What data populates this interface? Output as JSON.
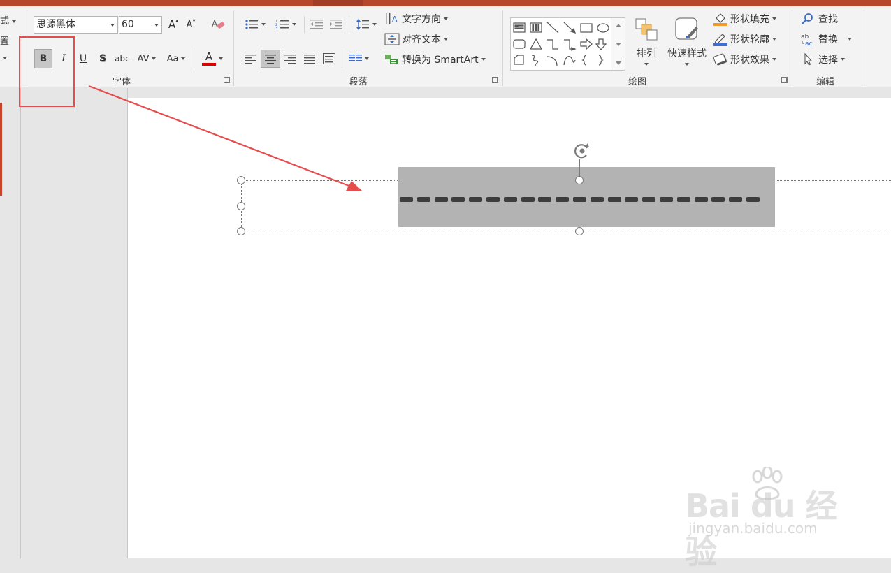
{
  "ribbon": {
    "cut_left": {
      "style_label": "式",
      "reset_label": "置"
    },
    "font": {
      "group_label": "字体",
      "font_name": "思源黑体",
      "font_size": "60",
      "bold": "B",
      "italic": "I",
      "underline": "U",
      "shadow": "S",
      "strike": "abc",
      "spacing": "AV",
      "case": "Aa",
      "color_letter": "A",
      "grow": "A",
      "shrink": "A"
    },
    "paragraph": {
      "group_label": "段落",
      "text_direction": "文字方向",
      "align_text": "对齐文本",
      "smartart": "转换为 SmartArt"
    },
    "drawing": {
      "group_label": "绘图",
      "arrange": "排列",
      "quick_styles": "快速样式",
      "shape_fill": "形状填充",
      "shape_outline": "形状轮廓",
      "shape_effects": "形状效果"
    },
    "editing": {
      "group_label": "编辑",
      "find": "查找",
      "replace": "替换",
      "select": "选择"
    }
  },
  "watermark": {
    "brand": "Bai du 经验",
    "url": "jingyan.baidu.com"
  },
  "colors": {
    "accent": "#b7472a",
    "annotation": "#e74c4c",
    "font_color": "#e00000",
    "fill_icon": "#f29a30",
    "outline_icon": "#3c6fd6"
  }
}
